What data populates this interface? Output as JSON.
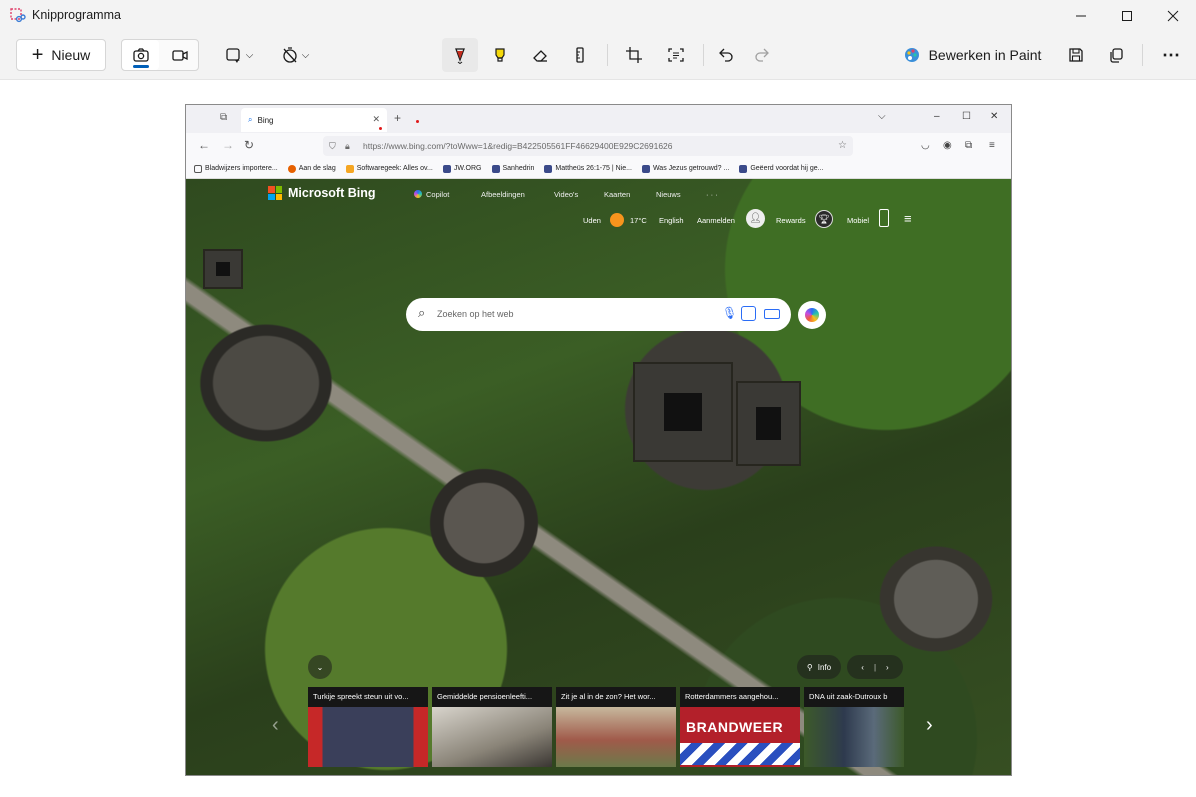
{
  "app": {
    "title": "Knipprogramma",
    "new_label": "Nieuw",
    "paint_label": "Bewerken in Paint",
    "more_label": "⋯"
  },
  "browser": {
    "tab_title": "Bing",
    "url": "https://www.bing.com/?toWww=1&redig=B422505561FF46629400E929C2691626",
    "bookmarks": [
      "Bladwijzers importere...",
      "Aan de slag",
      "Softwaregeek: Alles ov...",
      "JW.ORG",
      "Sanhedrin",
      "Mattheüs 26:1-75 | Nie...",
      "Was Jezus getrouwd? ...",
      "Geëerd voordat hij ge..."
    ]
  },
  "bing": {
    "logo": "Microsoft Bing",
    "nav": [
      "Copilot",
      "Afbeeldingen",
      "Video's",
      "Kaarten",
      "Nieuws",
      "· · ·"
    ],
    "location": "Uden",
    "temperature": "17°C",
    "language": "English",
    "signin": "Aanmelden",
    "rewards": "Rewards",
    "mobile": "Mobiel",
    "search_placeholder": "Zoeken op het web",
    "info_label": "Info",
    "news": [
      "Turkije spreekt steun uit vo...",
      "Gemiddelde pensioenleefti...",
      "Zit je al in de zon? Het wor...",
      "Rotterdammers aangehou...",
      "DNA uit zaak-Dutroux b"
    ],
    "brandweer_text": "BRANDWEER"
  },
  "colors": {
    "accent": "#005fb8",
    "pen_red": "#c42b1c",
    "highlighter_yellow": "#f5d90a"
  }
}
